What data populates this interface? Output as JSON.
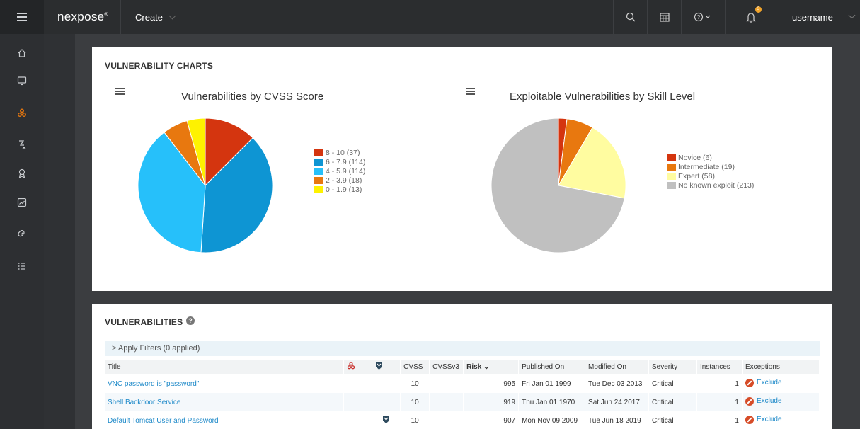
{
  "topbar": {
    "logo": "nexpose",
    "logo_mark": "®",
    "create_label": "Create",
    "notification_count": "3",
    "username": "username"
  },
  "sidebar": {
    "items": [
      {
        "icon": "home-icon"
      },
      {
        "icon": "monitor-icon"
      },
      {
        "icon": "biohazard-icon",
        "active": true
      },
      {
        "icon": "policy-icon"
      },
      {
        "icon": "award-icon"
      },
      {
        "icon": "reports-icon"
      },
      {
        "icon": "tag-icon"
      },
      {
        "icon": "list-icon"
      }
    ]
  },
  "charts_panel": {
    "title": "VULNERABILITY CHARTS"
  },
  "chart_data": [
    {
      "type": "pie",
      "title": "Vulnerabilities by CVSS Score",
      "categories": [
        "8 - 10 (37)",
        "6 - 7.9 (114)",
        "4 - 5.9 (114)",
        "2 - 3.9 (18)",
        "0 - 1.9 (13)"
      ],
      "values": [
        37,
        114,
        114,
        18,
        13
      ],
      "colors": [
        "#d4350f",
        "#0e95d3",
        "#26c0fa",
        "#e8780f",
        "#fef200"
      ],
      "legend": "right"
    },
    {
      "type": "pie",
      "title": "Exploitable Vulnerabilities by Skill Level",
      "categories": [
        "Novice (6)",
        "Intermediate (19)",
        "Expert (58)",
        "No known exploit (213)"
      ],
      "values": [
        6,
        19,
        58,
        213
      ],
      "colors": [
        "#d4350f",
        "#e8780f",
        "#fffca0",
        "#c0c0c0"
      ],
      "legend": "right"
    }
  ],
  "vulns_panel": {
    "title": "VULNERABILITIES",
    "filters_label": "> Apply Filters (0 applied)",
    "columns": {
      "title": "Title",
      "cvss": "CVSS",
      "cvssv3": "CVSSv3",
      "risk": "Risk",
      "published": "Published On",
      "modified": "Modified On",
      "severity": "Severity",
      "instances": "Instances",
      "exceptions": "Exceptions"
    },
    "rows": [
      {
        "title": "VNC password is \"password\"",
        "cvss": "10",
        "risk": "995",
        "published": "Fri Jan 01 1999",
        "modified": "Tue Dec 03 2013",
        "severity": "Critical",
        "instances": "1",
        "exception": "Exclude"
      },
      {
        "title": "Shell Backdoor Service",
        "cvss": "10",
        "risk": "919",
        "published": "Thu Jan 01 1970",
        "modified": "Sat Jun 24 2017",
        "severity": "Critical",
        "instances": "1",
        "exception": "Exclude"
      },
      {
        "title": "Default Tomcat User and Password",
        "cvss": "10",
        "risk": "907",
        "published": "Mon Nov 09 2009",
        "modified": "Tue Jun 18 2019",
        "severity": "Critical",
        "instances": "1",
        "exception": "Exclude"
      }
    ]
  }
}
